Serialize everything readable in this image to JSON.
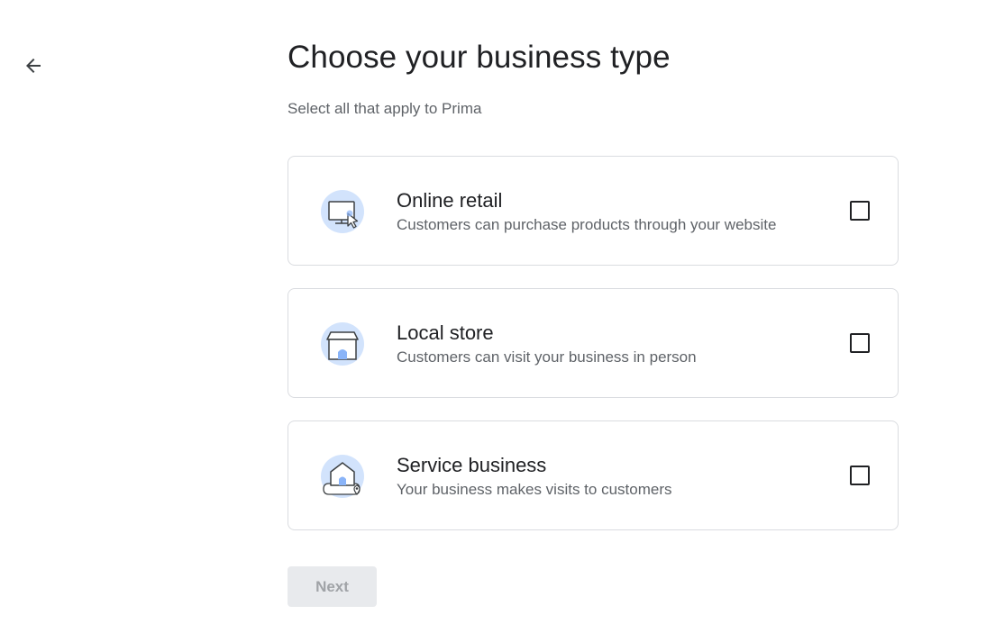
{
  "page": {
    "title": "Choose your business type",
    "subtitle": "Select all that apply to Prima"
  },
  "options": [
    {
      "title": "Online retail",
      "description": "Customers can purchase products through your website",
      "icon": "monitor-cursor-icon",
      "checked": false
    },
    {
      "title": "Local store",
      "description": "Customers can visit your business in person",
      "icon": "storefront-icon",
      "checked": false
    },
    {
      "title": "Service business",
      "description": "Your business makes visits to customers",
      "icon": "house-location-icon",
      "checked": false
    }
  ],
  "next_button": {
    "label": "Next",
    "disabled": true
  },
  "colors": {
    "icon_circle": "#d2e3fc",
    "border": "#dadce0",
    "text_primary": "#202124",
    "text_secondary": "#5f6368",
    "disabled_bg": "#e8eaed",
    "disabled_text": "#a0a3a7"
  }
}
